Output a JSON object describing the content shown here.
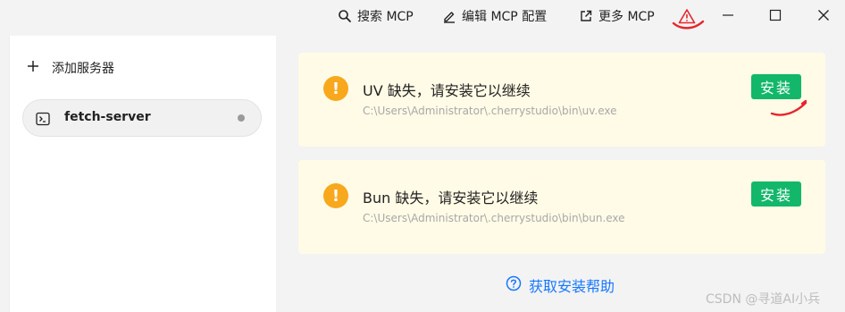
{
  "toolbar": {
    "search_label": "搜索 MCP",
    "edit_label": "编辑 MCP 配置",
    "more_label": "更多 MCP"
  },
  "sidebar": {
    "add_label": "添加服务器",
    "items": [
      {
        "name": "fetch-server"
      }
    ]
  },
  "cards": [
    {
      "title": "UV 缺失，请安装它以继续",
      "path": "C:\\Users\\Administrator\\.cherrystudio\\bin\\uv.exe",
      "button": "安装"
    },
    {
      "title": "Bun 缺失，请安装它以继续",
      "path": "C:\\Users\\Administrator\\.cherrystudio\\bin\\bun.exe",
      "button": "安装"
    }
  ],
  "help_label": "获取安装帮助",
  "watermark": "CSDN @寻道AI小兵",
  "colors": {
    "accent_green": "#12b76a",
    "warning_orange": "#f8a81d",
    "card_bg": "#fffbe6",
    "link_blue": "#1677ff",
    "annotation_red": "#e5262b"
  }
}
